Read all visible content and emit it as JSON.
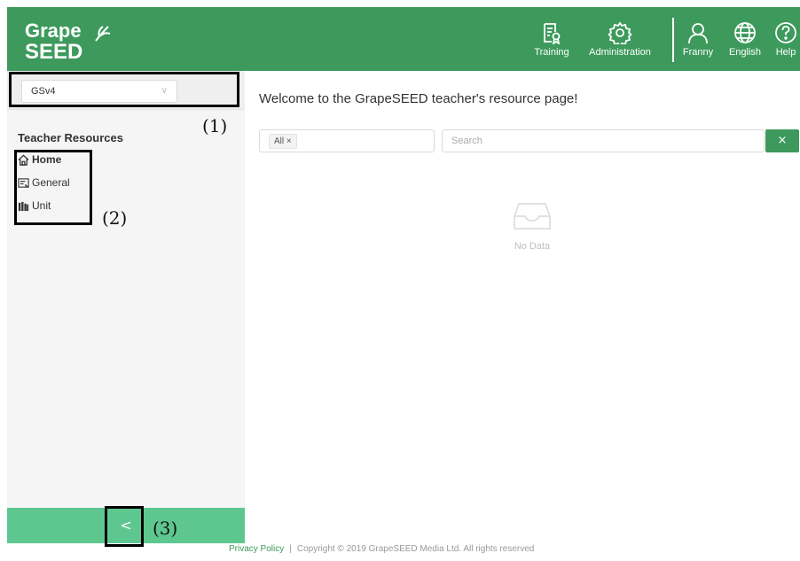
{
  "header": {
    "logo_text_top": "Grape",
    "logo_text_bottom": "SEED",
    "nav": [
      {
        "label": "Training",
        "icon": "training-icon"
      },
      {
        "label": "Administration",
        "icon": "gear-icon"
      },
      {
        "label": "Franny",
        "icon": "user-icon"
      },
      {
        "label": "English",
        "icon": "globe-icon"
      },
      {
        "label": "Help",
        "icon": "help-icon"
      }
    ]
  },
  "sidebar": {
    "version_select": "GSv4",
    "section_title": "Teacher Resources",
    "items": [
      {
        "label": "Home",
        "icon": "home-icon",
        "active": true
      },
      {
        "label": "General",
        "icon": "document-icon",
        "active": false
      },
      {
        "label": "Unit",
        "icon": "books-icon",
        "active": false
      }
    ],
    "collapse_glyph": "<"
  },
  "annotations": {
    "one": "(1)",
    "two": "(2)",
    "three": "(3)"
  },
  "main": {
    "title": "Welcome to the GrapeSEED teacher's resource page!",
    "filter_tag": "All ×",
    "search_placeholder": "Search",
    "clear_glyph": "×",
    "empty_text": "No Data"
  },
  "footer": {
    "privacy": "Privacy Policy",
    "separator": "|",
    "copyright": "Copyright © 2019 GrapeSEED Media Ltd. All rights reserved"
  },
  "colors": {
    "brand_green": "#3d9a5c",
    "collapse_green": "#5ec790",
    "sidebar_bg": "#f5f5f5"
  }
}
